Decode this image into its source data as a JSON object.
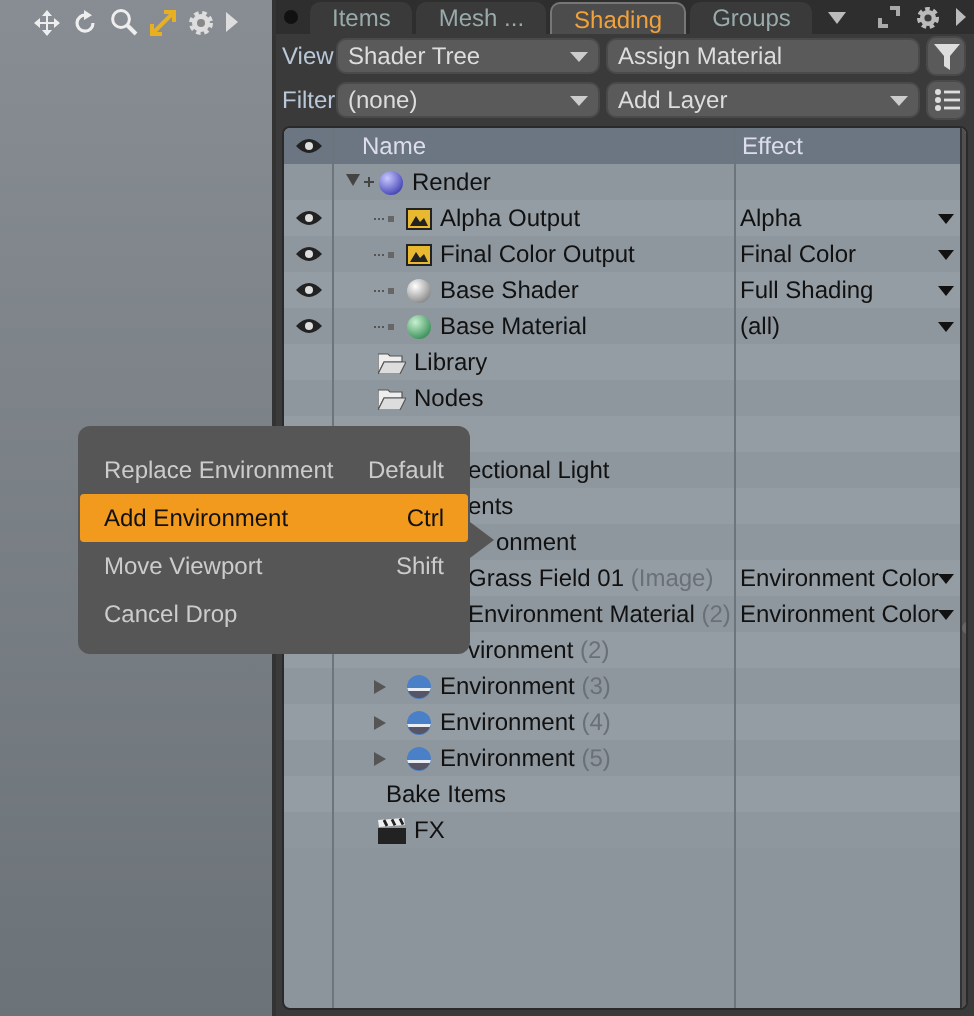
{
  "tabs": [
    {
      "label": "Items",
      "selected": false
    },
    {
      "label": "Mesh ...",
      "selected": false
    },
    {
      "label": "Shading",
      "selected": true
    },
    {
      "label": "Groups",
      "selected": false
    }
  ],
  "view": {
    "label": "View",
    "value": "Shader Tree",
    "action": "Assign Material"
  },
  "filter": {
    "label": "Filter",
    "value": "(none)",
    "action": "Add Layer"
  },
  "tree": {
    "columns": [
      "Name",
      "Effect"
    ],
    "rows": [
      {
        "kind": "render",
        "label": "Render",
        "expanded": true,
        "children": [
          {
            "kind": "output",
            "label": "Alpha Output",
            "visible": true,
            "effect": "Alpha"
          },
          {
            "kind": "output",
            "label": "Final Color Output",
            "visible": true,
            "effect": "Final Color"
          },
          {
            "kind": "shader",
            "label": "Base Shader",
            "visible": true,
            "effect": "Full Shading"
          },
          {
            "kind": "material",
            "label": "Base Material",
            "visible": true,
            "effect": "(all)"
          }
        ]
      },
      {
        "kind": "folder",
        "label": "Library"
      },
      {
        "kind": "folder",
        "label": "Nodes"
      },
      {
        "kind": "hidden",
        "children": [
          {
            "kind": "partial",
            "label": "ectional Light"
          }
        ]
      },
      {
        "kind": "partial",
        "label": "ents",
        "children": [
          {
            "kind": "covered",
            "label": "onment",
            "children": [
              {
                "kind": "partial",
                "label": "Grass Field 01",
                "suffix": "(Image)",
                "effect": "Environment Color"
              },
              {
                "kind": "partial",
                "label": "Environment Material",
                "suffix": "(2)",
                "effect": "Environment Color"
              }
            ]
          },
          {
            "kind": "partial",
            "label": "vironment",
            "suffix": "(2)"
          },
          {
            "kind": "environment",
            "label": "Environment",
            "suffix": "(3)",
            "expanded": false
          },
          {
            "kind": "environment",
            "label": "Environment",
            "suffix": "(4)",
            "expanded": false
          },
          {
            "kind": "environment",
            "label": "Environment",
            "suffix": "(5)",
            "expanded": false
          }
        ]
      },
      {
        "kind": "plain",
        "label": "Bake Items"
      },
      {
        "kind": "fx",
        "label": "FX"
      }
    ]
  },
  "menu": [
    {
      "label": "Replace Environment",
      "shortcut": "Default",
      "selected": false
    },
    {
      "label": "Add Environment",
      "shortcut": "Ctrl",
      "selected": true
    },
    {
      "label": "Move Viewport",
      "shortcut": "Shift",
      "selected": false
    },
    {
      "label": "Cancel Drop",
      "selected": false
    }
  ]
}
